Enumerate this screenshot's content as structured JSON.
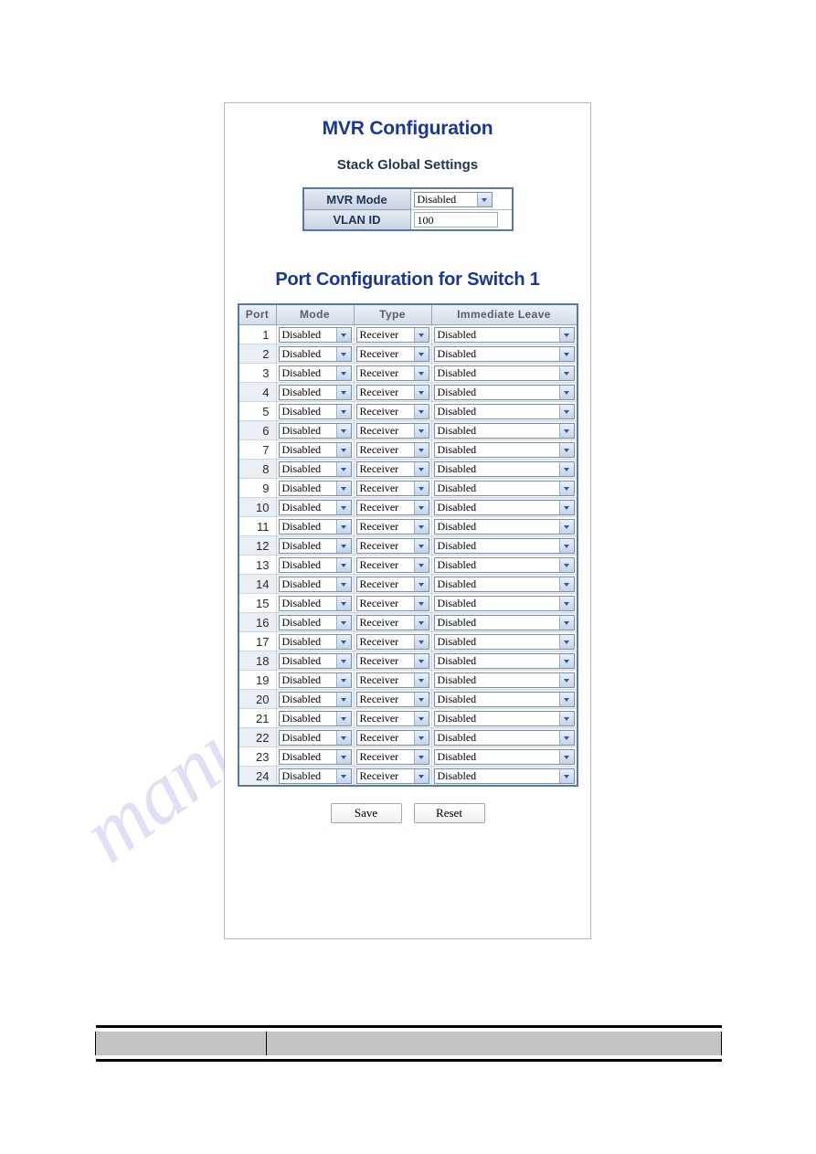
{
  "watermark": {
    "text": "manualslib.com"
  },
  "page": {
    "title": "MVR Configuration",
    "subtitle": "Stack Global Settings",
    "section_title": "Port Configuration for Switch 1"
  },
  "global_settings": {
    "rows": [
      {
        "label": "MVR Mode",
        "control": "select",
        "value": "Disabled"
      },
      {
        "label": "VLAN ID",
        "control": "text",
        "value": "100"
      }
    ]
  },
  "port_table": {
    "columns": [
      "Port",
      "Mode",
      "Type",
      "Immediate Leave"
    ],
    "rows": [
      {
        "port": "1",
        "mode": "Disabled",
        "type": "Receiver",
        "leave": "Disabled"
      },
      {
        "port": "2",
        "mode": "Disabled",
        "type": "Receiver",
        "leave": "Disabled"
      },
      {
        "port": "3",
        "mode": "Disabled",
        "type": "Receiver",
        "leave": "Disabled"
      },
      {
        "port": "4",
        "mode": "Disabled",
        "type": "Receiver",
        "leave": "Disabled"
      },
      {
        "port": "5",
        "mode": "Disabled",
        "type": "Receiver",
        "leave": "Disabled"
      },
      {
        "port": "6",
        "mode": "Disabled",
        "type": "Receiver",
        "leave": "Disabled"
      },
      {
        "port": "7",
        "mode": "Disabled",
        "type": "Receiver",
        "leave": "Disabled"
      },
      {
        "port": "8",
        "mode": "Disabled",
        "type": "Receiver",
        "leave": "Disabled"
      },
      {
        "port": "9",
        "mode": "Disabled",
        "type": "Receiver",
        "leave": "Disabled"
      },
      {
        "port": "10",
        "mode": "Disabled",
        "type": "Receiver",
        "leave": "Disabled"
      },
      {
        "port": "11",
        "mode": "Disabled",
        "type": "Receiver",
        "leave": "Disabled"
      },
      {
        "port": "12",
        "mode": "Disabled",
        "type": "Receiver",
        "leave": "Disabled"
      },
      {
        "port": "13",
        "mode": "Disabled",
        "type": "Receiver",
        "leave": "Disabled"
      },
      {
        "port": "14",
        "mode": "Disabled",
        "type": "Receiver",
        "leave": "Disabled"
      },
      {
        "port": "15",
        "mode": "Disabled",
        "type": "Receiver",
        "leave": "Disabled"
      },
      {
        "port": "16",
        "mode": "Disabled",
        "type": "Receiver",
        "leave": "Disabled"
      },
      {
        "port": "17",
        "mode": "Disabled",
        "type": "Receiver",
        "leave": "Disabled"
      },
      {
        "port": "18",
        "mode": "Disabled",
        "type": "Receiver",
        "leave": "Disabled"
      },
      {
        "port": "19",
        "mode": "Disabled",
        "type": "Receiver",
        "leave": "Disabled"
      },
      {
        "port": "20",
        "mode": "Disabled",
        "type": "Receiver",
        "leave": "Disabled"
      },
      {
        "port": "21",
        "mode": "Disabled",
        "type": "Receiver",
        "leave": "Disabled"
      },
      {
        "port": "22",
        "mode": "Disabled",
        "type": "Receiver",
        "leave": "Disabled"
      },
      {
        "port": "23",
        "mode": "Disabled",
        "type": "Receiver",
        "leave": "Disabled"
      },
      {
        "port": "24",
        "mode": "Disabled",
        "type": "Receiver",
        "leave": "Disabled"
      }
    ]
  },
  "buttons": {
    "save": "Save",
    "reset": "Reset"
  },
  "footer": {
    "cells": [
      "",
      ""
    ]
  },
  "colors": {
    "title_blue": "#19379b",
    "subtitle_blue": "#1d3557",
    "table_border": "#5579a6",
    "header_text": "#555f6b",
    "row_alt": "#eaeff6",
    "footer_cell": "#c4c4c4",
    "panel_border": "#b8b8b8",
    "watermark": "#9696e1"
  }
}
